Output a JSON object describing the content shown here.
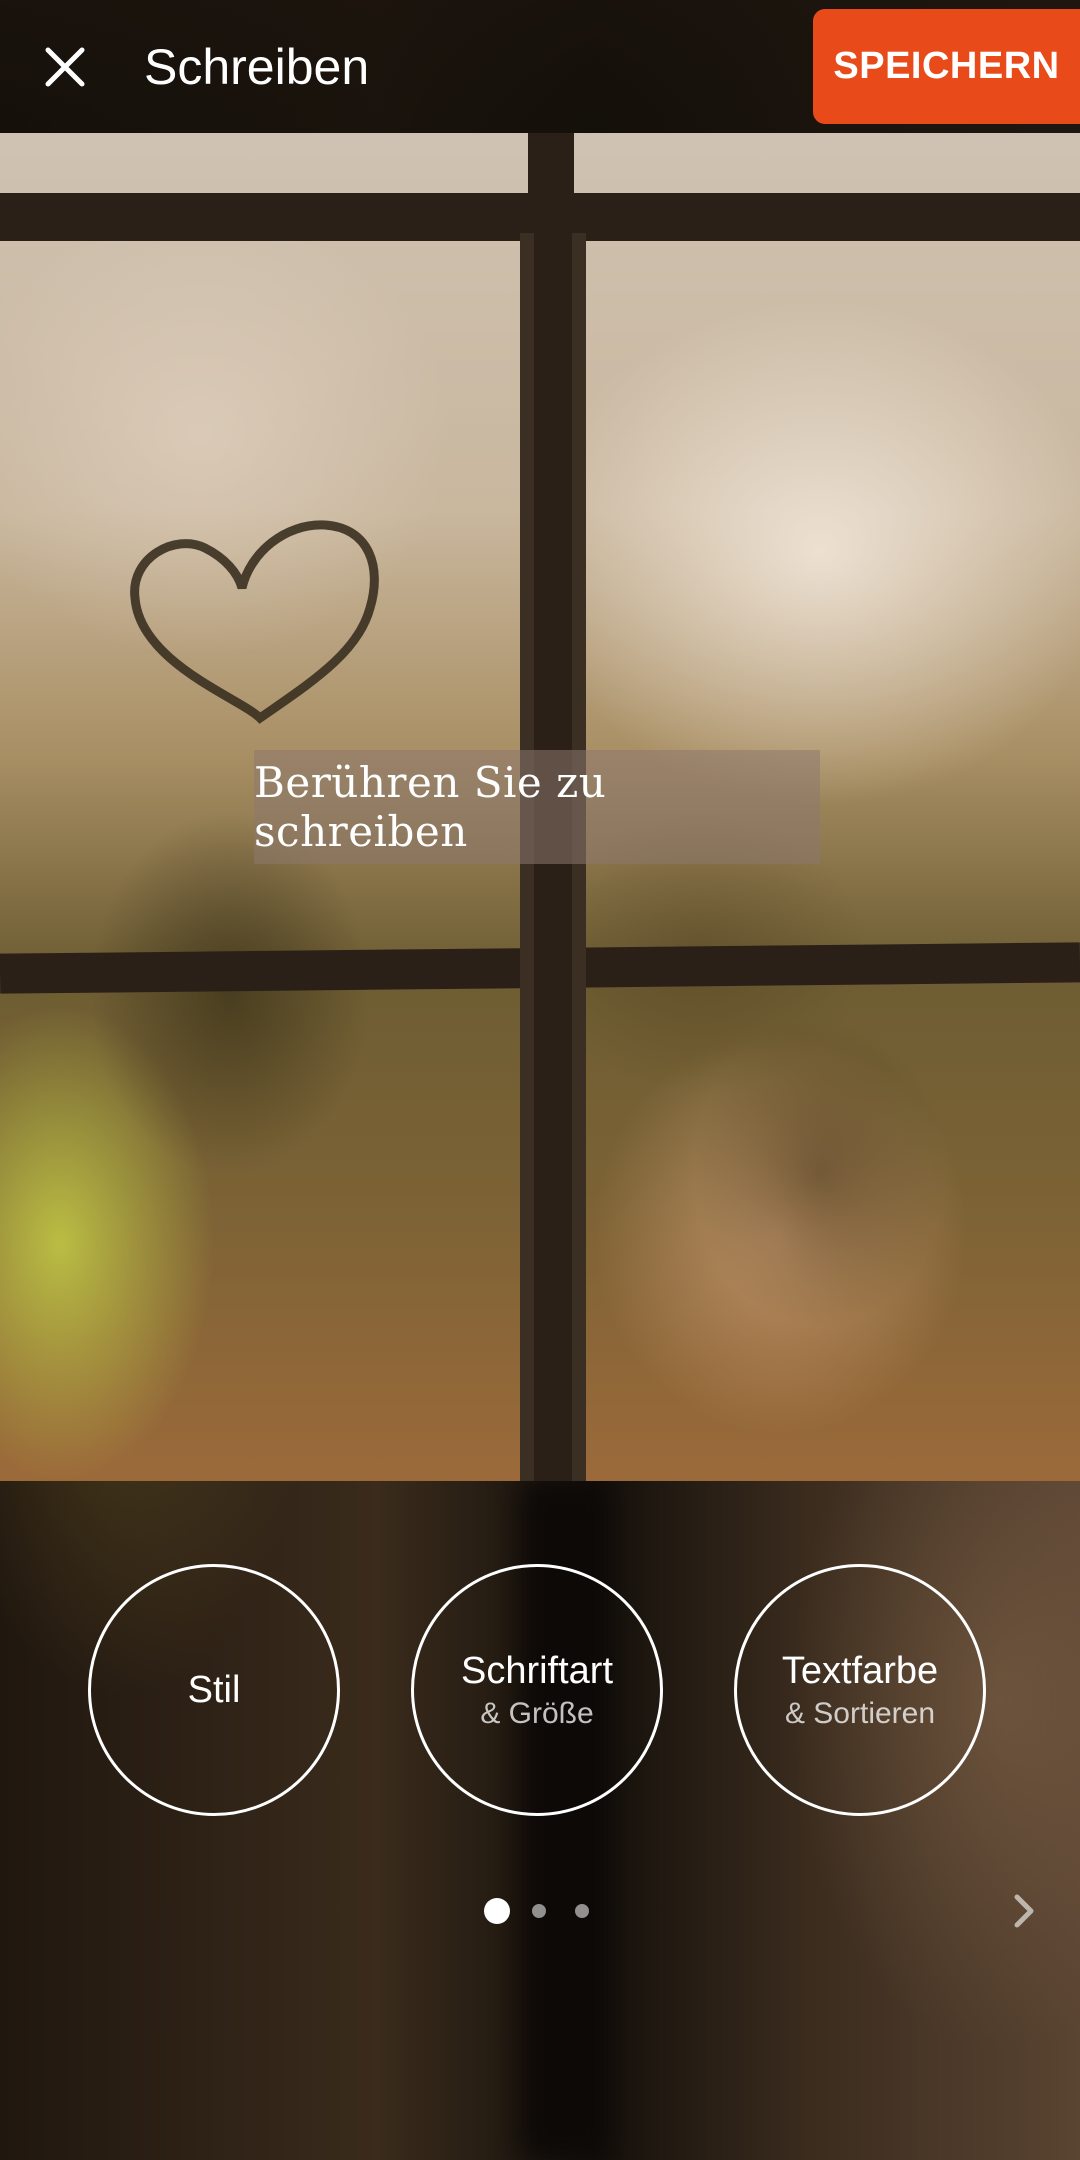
{
  "header": {
    "title": "Schreiben",
    "close_icon": "close-icon",
    "save_label": "SPEICHERN"
  },
  "canvas": {
    "hint": "Berühren Sie zu schreiben"
  },
  "options": [
    {
      "label": "Stil",
      "sub": ""
    },
    {
      "label": "Schriftart",
      "sub": "& Größe"
    },
    {
      "label": "Textfarbe",
      "sub": "& Sortieren"
    }
  ],
  "pager": {
    "page_count": 3,
    "active_page": 1,
    "next_icon": "chevron-right-icon"
  },
  "colors": {
    "accent": "#e84a1a"
  }
}
